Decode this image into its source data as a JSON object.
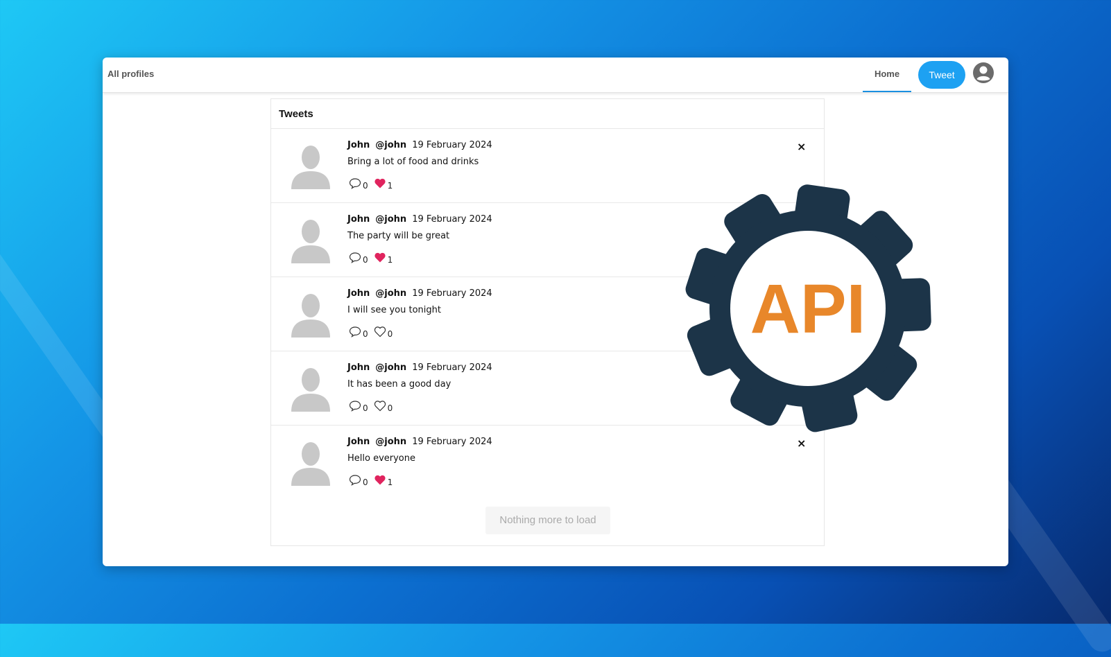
{
  "navbar": {
    "left_link": "All profiles",
    "home_tab": "Home",
    "tweet_button": "Tweet"
  },
  "feed": {
    "title": "Tweets",
    "tweets": [
      {
        "name": "John",
        "handle": "@john",
        "date": "19 February 2024",
        "text": "Bring a lot of food and drinks",
        "replies": "0",
        "likes": "1",
        "liked": true,
        "deletable": true
      },
      {
        "name": "John",
        "handle": "@john",
        "date": "19 February 2024",
        "text": "The party will be great",
        "replies": "0",
        "likes": "1",
        "liked": true,
        "deletable": true
      },
      {
        "name": "John",
        "handle": "@john",
        "date": "19 February 2024",
        "text": "I will see you tonight",
        "replies": "0",
        "likes": "0",
        "liked": false,
        "deletable": true
      },
      {
        "name": "John",
        "handle": "@john",
        "date": "19 February 2024",
        "text": "It has been a good day",
        "replies": "0",
        "likes": "0",
        "liked": false,
        "deletable": true
      },
      {
        "name": "John",
        "handle": "@john",
        "date": "19 February 2024",
        "text": "Hello everyone",
        "replies": "0",
        "likes": "1",
        "liked": true,
        "deletable": true
      }
    ],
    "load_more": "Nothing more to load"
  },
  "overlay_logo": {
    "text": "API",
    "gear_color": "#1c3448",
    "text_color": "#e8872a"
  },
  "icons": {
    "reply": "speech-bubble-icon",
    "like": "heart-icon",
    "delete": "close-icon",
    "avatar": "user-silhouette-icon",
    "profile": "account-circle-icon"
  },
  "colors": {
    "accent": "#1da1f2",
    "like": "#e0245e",
    "tab_underline": "#1a8fe0"
  }
}
